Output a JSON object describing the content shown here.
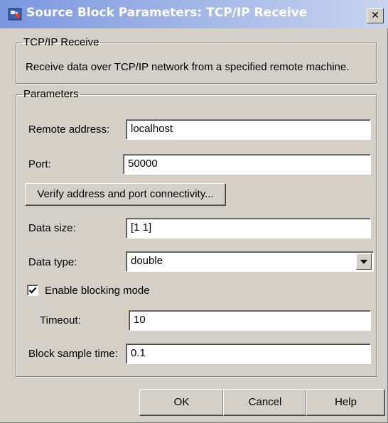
{
  "window": {
    "title": "Source Block Parameters: TCP/IP Receive",
    "close_glyph": "✕"
  },
  "block_group": {
    "legend": "TCP/IP Receive",
    "description": "Receive data over TCP/IP network from a specified remote machine."
  },
  "params_group": {
    "legend": "Parameters",
    "remote_address": {
      "label": "Remote address:",
      "value": "localhost"
    },
    "port": {
      "label": "Port:",
      "value": "50000"
    },
    "verify_button": "Verify address and port connectivity...",
    "data_size": {
      "label": "Data size:",
      "value": "[1 1]"
    },
    "data_type": {
      "label": "Data type:",
      "value": "double"
    },
    "enable_blocking": {
      "label": "Enable blocking mode",
      "checked": true
    },
    "timeout": {
      "label": "Timeout:",
      "value": "10"
    },
    "sample_time": {
      "label": "Block sample time:",
      "value": "0.1"
    }
  },
  "buttons": {
    "ok": "OK",
    "cancel": "Cancel",
    "help": "Help"
  },
  "colors": {
    "titlebar_start": "#7a96df",
    "titlebar_end": "#c8d4ee",
    "face": "#d4d0c8"
  }
}
